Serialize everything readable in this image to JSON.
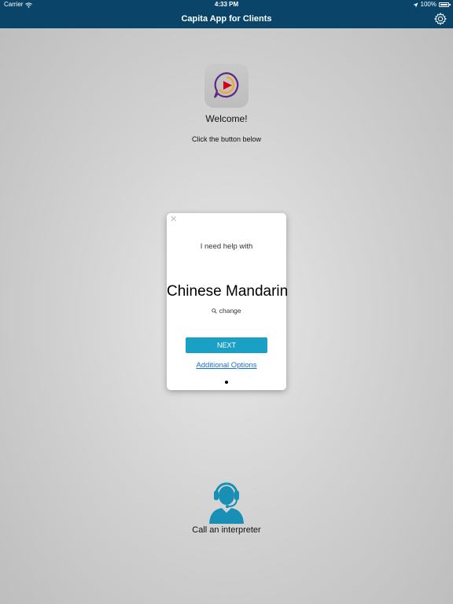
{
  "status_bar": {
    "carrier": "Carrier",
    "time": "4:33 PM",
    "battery": "100%",
    "battery_level": 1.0
  },
  "navbar": {
    "title": "Capita App for Clients",
    "settings_icon": "gear-icon"
  },
  "welcome": {
    "heading": "Welcome!",
    "instruction": "Click the button below"
  },
  "card": {
    "close_icon": "close-icon",
    "prompt": "I need help with",
    "language": "Chinese Mandarin",
    "change_label": "change",
    "next_label": "NEXT",
    "additional_label": "Additional Options",
    "page_indicator": {
      "count": 1,
      "active": 1
    }
  },
  "call": {
    "icon": "headset-person-icon",
    "label": "Call an interpreter"
  },
  "colors": {
    "navbar": "#0a4569",
    "accent": "#1aa0c4",
    "link": "#1a6fd6",
    "logo_purple": "#5b2a86",
    "logo_orange": "#f5a623",
    "logo_red": "#d0021b",
    "interpreter_icon": "#1a8fb5"
  }
}
